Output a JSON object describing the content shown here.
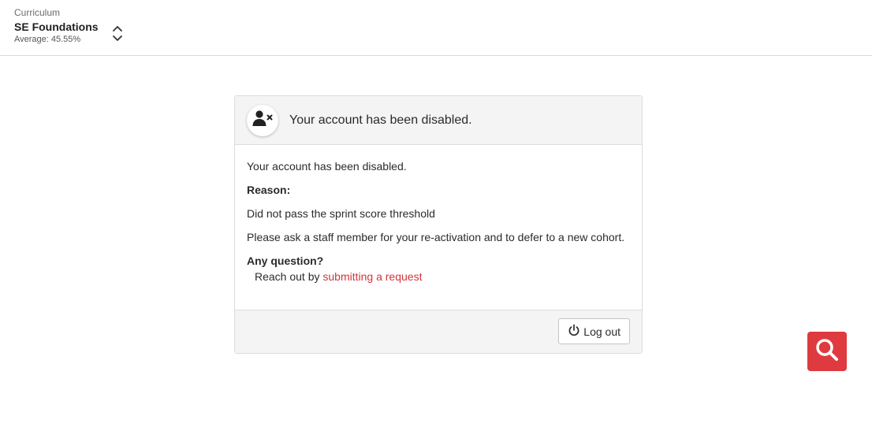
{
  "header": {
    "curriculum_label": "Curriculum",
    "curriculum_name": "SE Foundations",
    "average": "Average: 45.55%"
  },
  "card": {
    "title": "Your account has been disabled.",
    "body_line1": "Your account has been disabled.",
    "reason_label": "Reason:",
    "reason_text": "Did not pass the sprint score threshold",
    "instruction": "Please ask a staff member for your re-activation and to defer to a new cohort.",
    "question_label": "Any question?",
    "reach_out_prefix": "Reach out by ",
    "reach_out_link": "submitting a request",
    "logout_label": "Log out"
  },
  "icons": {
    "account_disabled": "user-x-icon",
    "chevrons": "chevron-up-down-icon",
    "power": "power-icon",
    "search": "search-icon"
  },
  "colors": {
    "accent": "#de3a3f",
    "link": "#d2353b",
    "header_bg": "#f4f4f4"
  }
}
